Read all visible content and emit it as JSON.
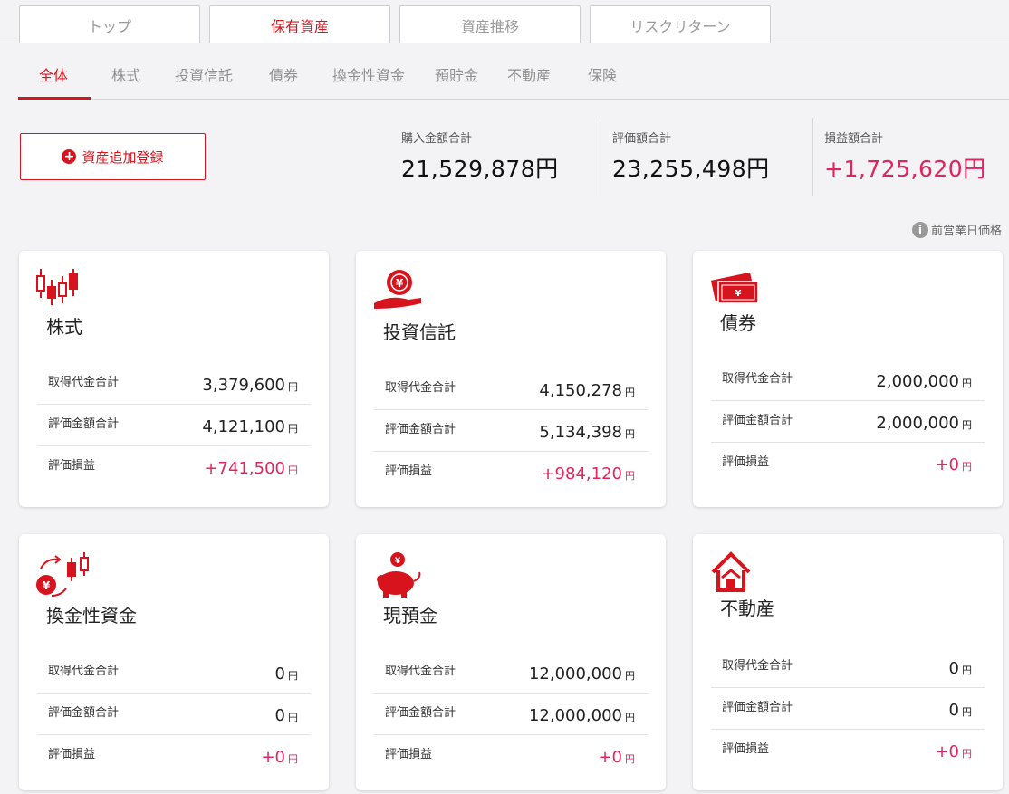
{
  "top_tabs": [
    "トップ",
    "保有資産",
    "資産推移",
    "リスクリターン"
  ],
  "sub_nav": [
    "全体",
    "株式",
    "投資信託",
    "債券",
    "換金性資金",
    "預貯金",
    "不動産",
    "保険"
  ],
  "add_button": "資産追加登録",
  "totals": [
    {
      "label": "購入金額合計",
      "value": "21,529,878円"
    },
    {
      "label": "評価額合計",
      "value": "23,255,498円"
    },
    {
      "label": "損益額合計",
      "value": "+1,725,620円"
    }
  ],
  "note": "前営業日価格",
  "yen": "円",
  "cards": [
    {
      "title": "株式",
      "icon": "candlestick-icon",
      "rows": [
        {
          "label": "取得代金合計",
          "value": "3,379,600"
        },
        {
          "label": "評価金額合計",
          "value": "4,121,100"
        },
        {
          "label": "評価損益",
          "value": "+741,500"
        }
      ]
    },
    {
      "title": "投資信託",
      "icon": "yen-hand-icon",
      "rows": [
        {
          "label": "取得代金合計",
          "value": "4,150,278"
        },
        {
          "label": "評価金額合計",
          "value": "5,134,398"
        },
        {
          "label": "評価損益",
          "value": "+984,120"
        }
      ]
    },
    {
      "title": "債券",
      "icon": "bond-notes-icon",
      "rows": [
        {
          "label": "取得代金合計",
          "value": "2,000,000"
        },
        {
          "label": "評価金額合計",
          "value": "2,000,000"
        },
        {
          "label": "評価損益",
          "value": "+0"
        }
      ]
    },
    {
      "title": "換金性資金",
      "icon": "cash-convert-icon",
      "rows": [
        {
          "label": "取得代金合計",
          "value": "0"
        },
        {
          "label": "評価金額合計",
          "value": "0"
        },
        {
          "label": "評価損益",
          "value": "+0"
        }
      ]
    },
    {
      "title": "現預金",
      "icon": "piggy-bank-icon",
      "rows": [
        {
          "label": "取得代金合計",
          "value": "12,000,000"
        },
        {
          "label": "評価金額合計",
          "value": "12,000,000"
        },
        {
          "label": "評価損益",
          "value": "+0"
        }
      ]
    },
    {
      "title": "不動産",
      "icon": "house-icon",
      "rows": [
        {
          "label": "取得代金合計",
          "value": "0"
        },
        {
          "label": "評価金額合計",
          "value": "0"
        },
        {
          "label": "評価損益",
          "value": "+0"
        }
      ]
    }
  ],
  "colors": {
    "accent": "#d7141e",
    "positive": "#e0245e",
    "background": "#f3f3f5"
  }
}
